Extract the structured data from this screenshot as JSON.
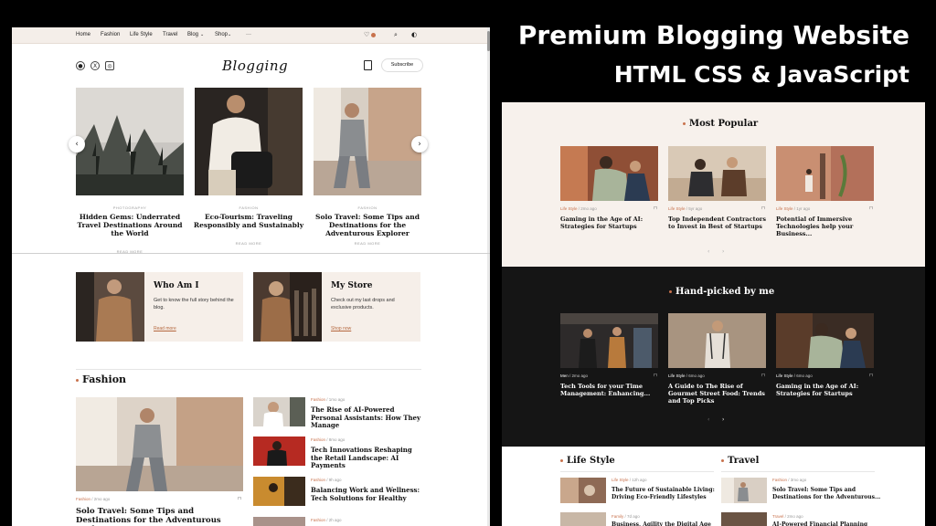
{
  "headline": {
    "line1": "Premium Blogging Website",
    "line2": "HTML CSS & JavaScript"
  },
  "nav": {
    "links": [
      "Home",
      "Fashion",
      "Life Style",
      "Travel",
      "Blog",
      "Shop"
    ],
    "more": "···"
  },
  "brand": "Blogging",
  "social": [
    "github-icon",
    "x-icon",
    "instagram-icon"
  ],
  "subscribe": "Subscribe",
  "slider": [
    {
      "category": "PHOTOGRAPHY",
      "title": "Hidden Gems: Underrated Travel Destinations Around the World",
      "read": "READ MORE"
    },
    {
      "category": "FASHION",
      "title": "Eco-Tourism: Traveling Responsibly and Sustainably",
      "read": "READ MORE"
    },
    {
      "category": "FASHION",
      "title": "Solo Travel: Some Tips and Destinations for the Adventurous Explorer",
      "read": "READ MORE"
    }
  ],
  "cards": [
    {
      "title": "Who Am I",
      "desc": "Get to know the full story behind the blog.",
      "link": "Read more"
    },
    {
      "title": "My Store",
      "desc": "Check out my last drops and exclusive products.",
      "link": "Shop now"
    }
  ],
  "fashion": {
    "heading": "Fashion",
    "main": {
      "category": "Fashion",
      "time": "2mo ago",
      "title": "Solo Travel: Some Tips and Destinations for the Adventurous Explorer"
    },
    "list": [
      {
        "category": "Fashion",
        "time": "1mo ago",
        "title": "The Rise of AI-Powered Personal Assistants: How They Manage"
      },
      {
        "category": "Fashion",
        "time": "8mo ago",
        "title": "Tech Innovations Reshaping the Retail Landscape: AI Payments"
      },
      {
        "category": "Fashion",
        "time": "9h ago",
        "title": "Balancing Work and Wellness: Tech Solutions for Healthy"
      },
      {
        "category": "Fashion",
        "time": "2h ago",
        "title": ""
      }
    ]
  },
  "most_popular": {
    "heading": "Most Popular",
    "items": [
      {
        "category": "Life Style",
        "time": "2mo ago",
        "title": "Gaming in the Age of AI: Strategies for Startups"
      },
      {
        "category": "Life Style",
        "time": "5yr ago",
        "title": "Top Independent Contractors to Invest in Best of Startups"
      },
      {
        "category": "Life Style",
        "time": "1yr ago",
        "title": "Potential of Immersive Technologies help your Business..."
      }
    ],
    "pager": [
      "‹",
      "›"
    ]
  },
  "hand_picked": {
    "heading": "Hand-picked by me",
    "items": [
      {
        "category": "Men",
        "time": "2mo ago",
        "title": "Tech Tools for your Time Management: Enhancing..."
      },
      {
        "category": "Life Style",
        "time": "6mo ago",
        "title": "A Guide to The Rise of Gourmet Street Food: Trends and Top Picks"
      },
      {
        "category": "Life Style",
        "time": "6mo ago",
        "title": "Gaming in the Age of AI: Strategies for Startups"
      }
    ],
    "pager": [
      "‹",
      "›"
    ]
  },
  "life_style": {
    "heading": "Life Style",
    "items": [
      {
        "category": "Life Style",
        "time": "12h ago",
        "title": "The Future of Sustainable Living: Driving Eco-Friendly Lifestyles"
      },
      {
        "category": "Family",
        "time": "7d ago",
        "title": "Business, Agility the Digital Age"
      }
    ]
  },
  "travel": {
    "heading": "Travel",
    "items": [
      {
        "category": "Fashion",
        "time": "3mo ago",
        "title": "Solo Travel: Some Tips and Destinations for the Adventurous..."
      },
      {
        "category": "Travel",
        "time": "2mo ago",
        "title": "AI-Powered Financial Planning"
      }
    ]
  },
  "colors": {
    "accent": "#c8724d",
    "cream": "#f7f1ec",
    "dark": "#151515"
  }
}
